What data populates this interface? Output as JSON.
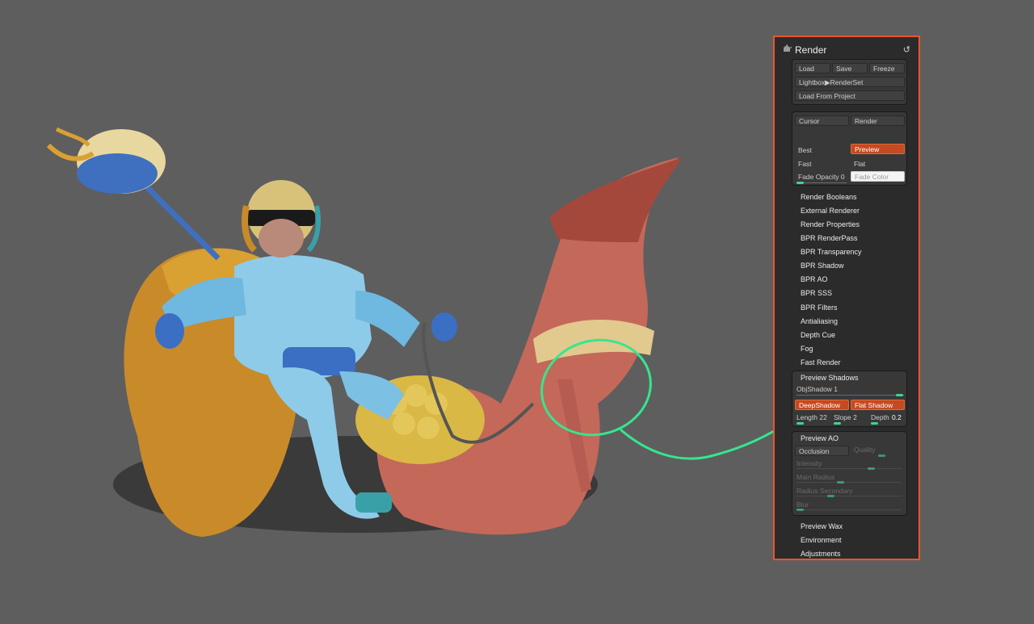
{
  "panel": {
    "title": "Render",
    "reset_icon": "↺",
    "header_icon": "teapot-icon",
    "file_group": {
      "load": "Load",
      "save": "Save",
      "freeze": "Freeze",
      "lightbox": "Lightbox▶RenderSet",
      "load_from_project": "Load From Project"
    },
    "render_group": {
      "cursor": "Cursor",
      "render": "Render",
      "best": "Best",
      "preview": "Preview",
      "fast": "Fast",
      "flat": "Flat",
      "fade_opacity": "Fade Opacity 0",
      "fade_opacity_value": 0,
      "fade_color": "Fade Color"
    },
    "menu_items": [
      "Render Booleans",
      "External Renderer",
      "Render Properties",
      "BPR RenderPass",
      "BPR Transparency",
      "BPR Shadow",
      "BPR AO",
      "BPR SSS",
      "BPR Filters",
      "Antialiasing",
      "Depth Cue",
      "Fog",
      "Fast Render"
    ],
    "preview_shadows": {
      "title": "Preview Shadows",
      "objshadow": "ObjShadow 1",
      "deepshadow": "DeepShadow",
      "flatshadow": "Flat Shadow",
      "length": "Length 22",
      "slope": "Slope 2",
      "depth_label": "Depth",
      "depth_value": "0.2"
    },
    "preview_ao": {
      "title": "Preview AO",
      "occlusion": "Occlusion",
      "quality": "Quality",
      "intensity": "Intensity",
      "main_radius": "Main Radius",
      "radius_secondary": "Radius Secondary",
      "blur": "Blur"
    },
    "bottom_items": [
      "Preview Wax",
      "Environment",
      "Adjustments"
    ]
  },
  "colors": {
    "accent_border": "#e8572a",
    "annotation": "#35e68f",
    "active_button": "#c44a22"
  }
}
